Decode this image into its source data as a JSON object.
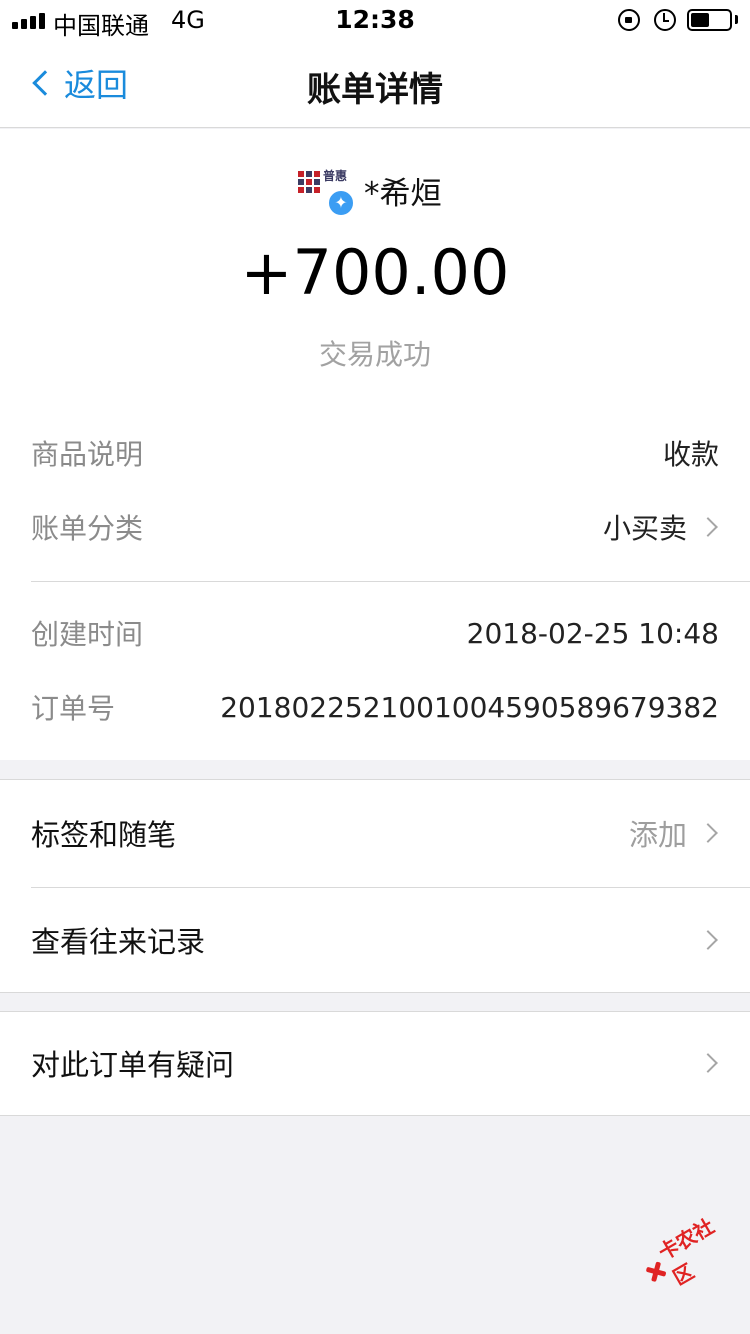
{
  "status_bar": {
    "carrier": "中国联通",
    "network": "4G",
    "time": "12:38",
    "battery_level": 0.48
  },
  "nav": {
    "back_label": "返回",
    "title": "账单详情"
  },
  "summary": {
    "logo_text": "普惠",
    "merchant_name": "*希烜",
    "amount": "+700.00",
    "status": "交易成功"
  },
  "details": [
    {
      "label": "商品说明",
      "value": "收款"
    },
    {
      "label": "账单分类",
      "value": "小买卖"
    },
    {
      "label": "创建时间",
      "value": "2018-02-25 10:48"
    },
    {
      "label": "订单号",
      "value": "2018022521001004590589679382"
    }
  ],
  "actions": [
    {
      "label": "标签和随笔",
      "hint": "添加"
    },
    {
      "label": "查看往来记录",
      "hint": ""
    },
    {
      "label": "对此订单有疑问",
      "hint": ""
    }
  ],
  "watermark": {
    "text": "卡农社区"
  },
  "colors": {
    "accent": "#1a8bdc",
    "background": "#f2f2f5",
    "muted": "#8b8b8b",
    "watermark": "#e02323"
  }
}
